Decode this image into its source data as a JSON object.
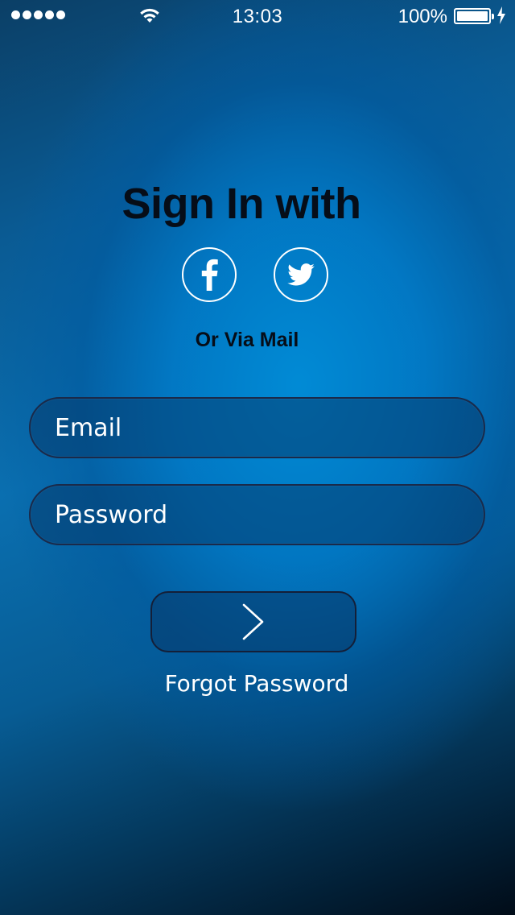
{
  "status_bar": {
    "time": "13:03",
    "battery_percent": "100%",
    "signal_bars": 5,
    "charging": true
  },
  "signin": {
    "title": "Sign In with",
    "social": [
      {
        "name": "facebook",
        "icon": "facebook-icon"
      },
      {
        "name": "twitter",
        "icon": "twitter-icon"
      }
    ],
    "or_via_mail": "Or Via Mail"
  },
  "form": {
    "email_placeholder": "Email",
    "email_value": "",
    "password_placeholder": "Password",
    "password_value": "",
    "submit_icon": "chevron-right-icon"
  },
  "links": {
    "forgot_password": "Forgot Password"
  },
  "colors": {
    "background_primary": "#0a6fb0",
    "background_dark": "#010c18",
    "text_dark": "#060d18",
    "text_light": "#ffffff"
  }
}
